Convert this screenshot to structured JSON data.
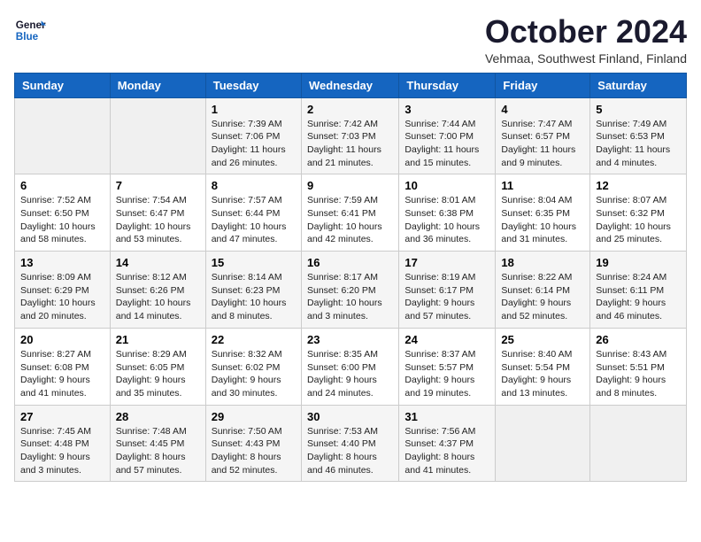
{
  "logo": {
    "general": "General",
    "blue": "Blue"
  },
  "header": {
    "month": "October 2024",
    "location": "Vehmaa, Southwest Finland, Finland"
  },
  "weekdays": [
    "Sunday",
    "Monday",
    "Tuesday",
    "Wednesday",
    "Thursday",
    "Friday",
    "Saturday"
  ],
  "weeks": [
    [
      {
        "day": "",
        "empty": true
      },
      {
        "day": "",
        "empty": true
      },
      {
        "day": "1",
        "sunrise": "7:39 AM",
        "sunset": "7:06 PM",
        "daylight": "11 hours and 26 minutes."
      },
      {
        "day": "2",
        "sunrise": "7:42 AM",
        "sunset": "7:03 PM",
        "daylight": "11 hours and 21 minutes."
      },
      {
        "day": "3",
        "sunrise": "7:44 AM",
        "sunset": "7:00 PM",
        "daylight": "11 hours and 15 minutes."
      },
      {
        "day": "4",
        "sunrise": "7:47 AM",
        "sunset": "6:57 PM",
        "daylight": "11 hours and 9 minutes."
      },
      {
        "day": "5",
        "sunrise": "7:49 AM",
        "sunset": "6:53 PM",
        "daylight": "11 hours and 4 minutes."
      }
    ],
    [
      {
        "day": "6",
        "sunrise": "7:52 AM",
        "sunset": "6:50 PM",
        "daylight": "10 hours and 58 minutes."
      },
      {
        "day": "7",
        "sunrise": "7:54 AM",
        "sunset": "6:47 PM",
        "daylight": "10 hours and 53 minutes."
      },
      {
        "day": "8",
        "sunrise": "7:57 AM",
        "sunset": "6:44 PM",
        "daylight": "10 hours and 47 minutes."
      },
      {
        "day": "9",
        "sunrise": "7:59 AM",
        "sunset": "6:41 PM",
        "daylight": "10 hours and 42 minutes."
      },
      {
        "day": "10",
        "sunrise": "8:01 AM",
        "sunset": "6:38 PM",
        "daylight": "10 hours and 36 minutes."
      },
      {
        "day": "11",
        "sunrise": "8:04 AM",
        "sunset": "6:35 PM",
        "daylight": "10 hours and 31 minutes."
      },
      {
        "day": "12",
        "sunrise": "8:07 AM",
        "sunset": "6:32 PM",
        "daylight": "10 hours and 25 minutes."
      }
    ],
    [
      {
        "day": "13",
        "sunrise": "8:09 AM",
        "sunset": "6:29 PM",
        "daylight": "10 hours and 20 minutes."
      },
      {
        "day": "14",
        "sunrise": "8:12 AM",
        "sunset": "6:26 PM",
        "daylight": "10 hours and 14 minutes."
      },
      {
        "day": "15",
        "sunrise": "8:14 AM",
        "sunset": "6:23 PM",
        "daylight": "10 hours and 8 minutes."
      },
      {
        "day": "16",
        "sunrise": "8:17 AM",
        "sunset": "6:20 PM",
        "daylight": "10 hours and 3 minutes."
      },
      {
        "day": "17",
        "sunrise": "8:19 AM",
        "sunset": "6:17 PM",
        "daylight": "9 hours and 57 minutes."
      },
      {
        "day": "18",
        "sunrise": "8:22 AM",
        "sunset": "6:14 PM",
        "daylight": "9 hours and 52 minutes."
      },
      {
        "day": "19",
        "sunrise": "8:24 AM",
        "sunset": "6:11 PM",
        "daylight": "9 hours and 46 minutes."
      }
    ],
    [
      {
        "day": "20",
        "sunrise": "8:27 AM",
        "sunset": "6:08 PM",
        "daylight": "9 hours and 41 minutes."
      },
      {
        "day": "21",
        "sunrise": "8:29 AM",
        "sunset": "6:05 PM",
        "daylight": "9 hours and 35 minutes."
      },
      {
        "day": "22",
        "sunrise": "8:32 AM",
        "sunset": "6:02 PM",
        "daylight": "9 hours and 30 minutes."
      },
      {
        "day": "23",
        "sunrise": "8:35 AM",
        "sunset": "6:00 PM",
        "daylight": "9 hours and 24 minutes."
      },
      {
        "day": "24",
        "sunrise": "8:37 AM",
        "sunset": "5:57 PM",
        "daylight": "9 hours and 19 minutes."
      },
      {
        "day": "25",
        "sunrise": "8:40 AM",
        "sunset": "5:54 PM",
        "daylight": "9 hours and 13 minutes."
      },
      {
        "day": "26",
        "sunrise": "8:43 AM",
        "sunset": "5:51 PM",
        "daylight": "9 hours and 8 minutes."
      }
    ],
    [
      {
        "day": "27",
        "sunrise": "7:45 AM",
        "sunset": "4:48 PM",
        "daylight": "9 hours and 3 minutes."
      },
      {
        "day": "28",
        "sunrise": "7:48 AM",
        "sunset": "4:45 PM",
        "daylight": "8 hours and 57 minutes."
      },
      {
        "day": "29",
        "sunrise": "7:50 AM",
        "sunset": "4:43 PM",
        "daylight": "8 hours and 52 minutes."
      },
      {
        "day": "30",
        "sunrise": "7:53 AM",
        "sunset": "4:40 PM",
        "daylight": "8 hours and 46 minutes."
      },
      {
        "day": "31",
        "sunrise": "7:56 AM",
        "sunset": "4:37 PM",
        "daylight": "8 hours and 41 minutes."
      },
      {
        "day": "",
        "empty": true
      },
      {
        "day": "",
        "empty": true
      }
    ]
  ]
}
